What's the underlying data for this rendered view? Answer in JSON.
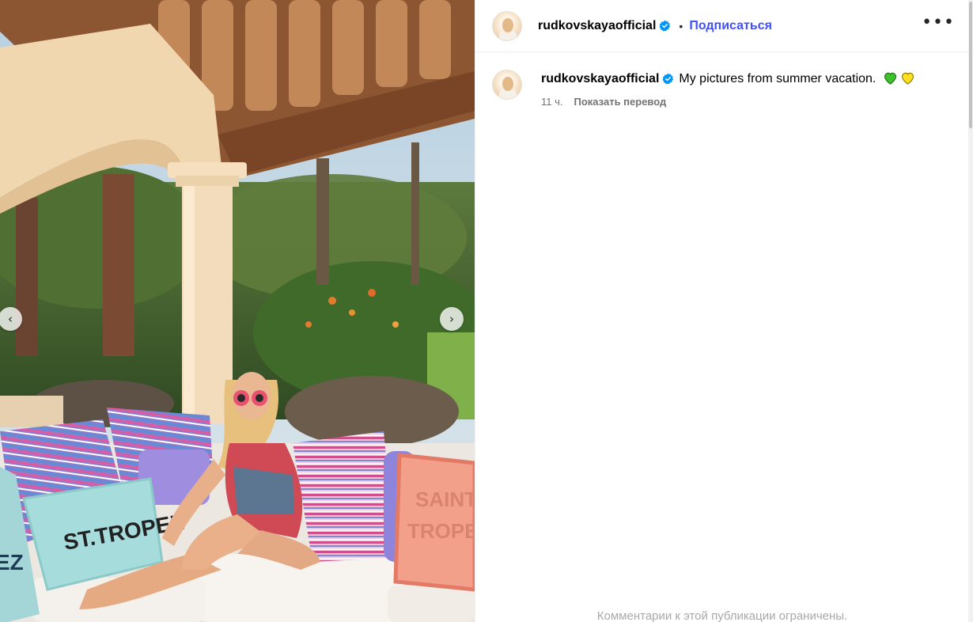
{
  "post": {
    "username": "rudkovskaya­official",
    "follow_label": "Подписаться",
    "dot": "•",
    "more_label": "•••",
    "caption_username": "rudkovskayaofficial",
    "caption_text": "My pictures from summer vacation.",
    "hearts": [
      "green-heart-emoji",
      "yellow-heart-emoji"
    ],
    "time_ago": "11 ч.",
    "translate_label": "Показать перевод",
    "comments_disabled": "Комментарии к этой публикации ограничены."
  },
  "carousel": {
    "prev_icon": "chevron-left-icon",
    "next_icon": "chevron-right-icon",
    "prev_glyph": "‹",
    "next_glyph": "›"
  },
  "photo": {
    "pillow_text_left": "ST.TROPEZ",
    "pillow_text_right_1": "SAINT",
    "pillow_text_right_2": "TROPEZ",
    "pillow_text_edge": "EZ"
  },
  "colors": {
    "follow": "#4150f7",
    "verified": "#0095f6",
    "muted": "#737373"
  }
}
